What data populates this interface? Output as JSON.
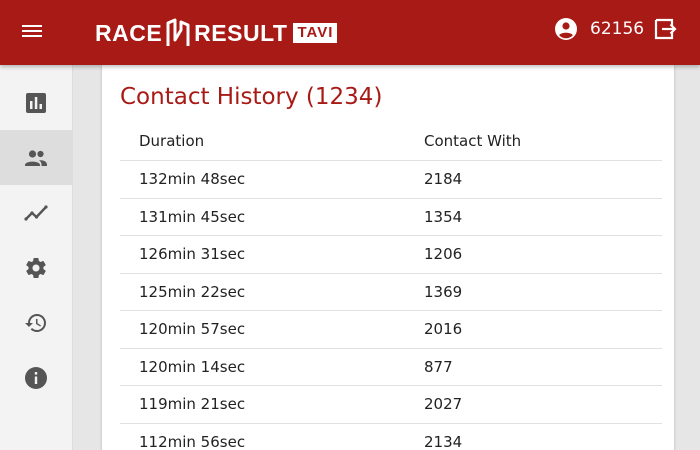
{
  "header": {
    "logo_left": "RACE",
    "logo_right": "RESULT",
    "logo_badge": "TAVI",
    "user_id": "62156",
    "accent_color": "#a81a16"
  },
  "sidebar": {
    "items": [
      {
        "icon": "bar-chart-icon",
        "active": false
      },
      {
        "icon": "people-icon",
        "active": true
      },
      {
        "icon": "trending-line-icon",
        "active": false
      },
      {
        "icon": "gear-icon",
        "active": false
      },
      {
        "icon": "history-icon",
        "active": false
      },
      {
        "icon": "info-icon",
        "active": false
      }
    ]
  },
  "main": {
    "title": "Contact History (1234)",
    "columns": [
      "Duration",
      "Contact With"
    ],
    "rows": [
      [
        "132min 48sec",
        "2184"
      ],
      [
        "131min 45sec",
        "1354"
      ],
      [
        "126min 31sec",
        "1206"
      ],
      [
        "125min 22sec",
        "1369"
      ],
      [
        "120min 57sec",
        "2016"
      ],
      [
        "120min 14sec",
        "877"
      ],
      [
        "119min 21sec",
        "2027"
      ],
      [
        "112min 56sec",
        "2134"
      ]
    ]
  }
}
